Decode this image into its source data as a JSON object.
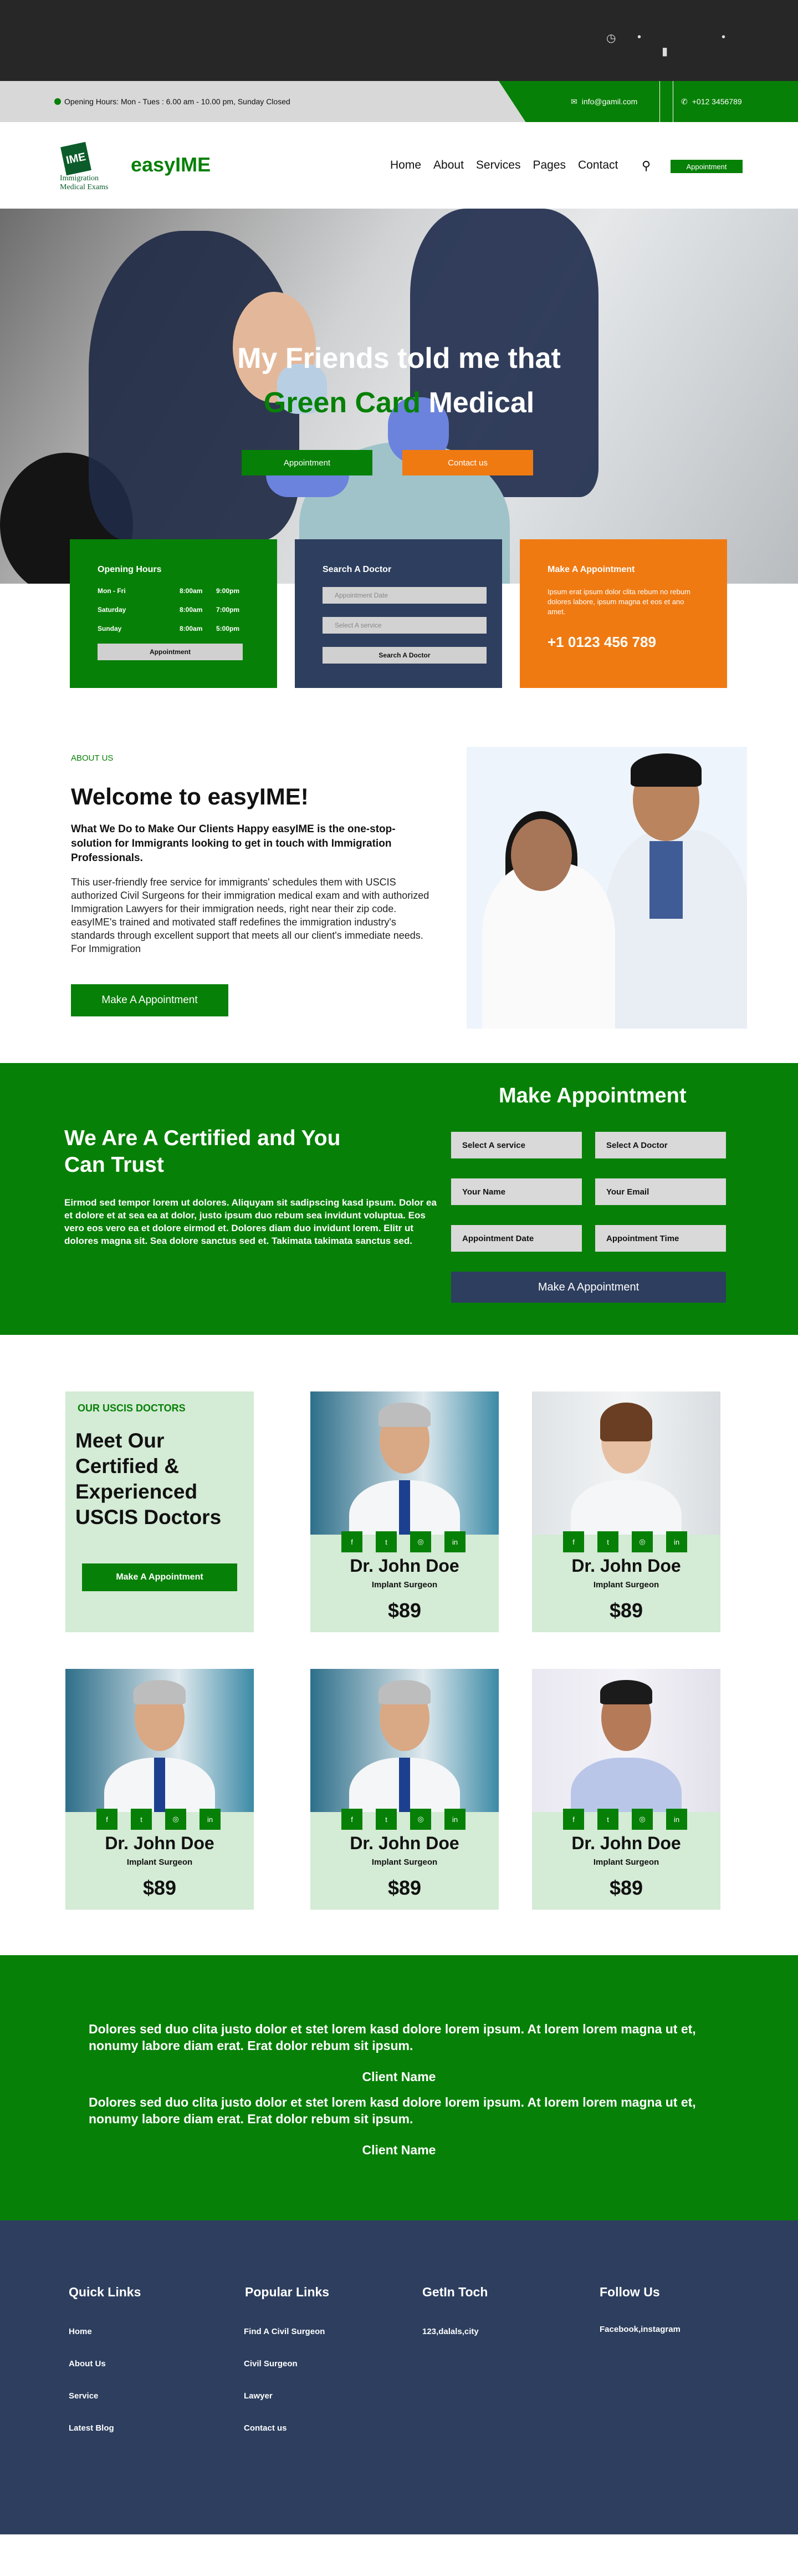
{
  "topbar": {
    "hours": "Opening Hours: Mon - Tues : 6.00 am - 10.00 pm, Sunday Closed",
    "email": "info@gamil.com",
    "phone": "+012 3456789"
  },
  "nav": {
    "logo_text": "Immigration Medical Exams",
    "logo_mark": "IME",
    "brand": "easyIME",
    "menu": [
      "Home",
      "About",
      "Services",
      "Pages",
      "Contact"
    ],
    "appointment": "Appointment"
  },
  "hero": {
    "line1": "My Friends told me that",
    "line2a": "Green Card",
    "line2b": " Medical",
    "btn_primary": "Appointment",
    "btn_secondary": "Contact us"
  },
  "cards": {
    "hours": {
      "title": "Opening Hours",
      "rows": [
        [
          "Mon - Fri",
          "8:00am",
          "9:00pm"
        ],
        [
          "Saturday",
          "8:00am",
          "7:00pm"
        ],
        [
          "Sunday",
          "8:00am",
          "5:00pm"
        ]
      ],
      "button": "Appointment"
    },
    "search": {
      "title": "Search A Doctor",
      "date_placeholder": "Appointment Date",
      "service_placeholder": "Select A service",
      "button": "Search A Doctor"
    },
    "make": {
      "title": "Make A Appointment",
      "text": "Ipsum erat ipsum dolor clita rebum no rebum dolores labore, ipsum magna et eos et ano amet.",
      "phone": "+1 0123 456 789"
    }
  },
  "about": {
    "tag": "ABOUT US",
    "title": "Welcome to easyIME!",
    "lead": "What We Do to Make Our Clients Happy easyIME is the one-stop-solution for Immigrants looking to get in touch with Immigration Professionals.",
    "body": "This user-friendly free service for immigrants' schedules them with USCIS authorized Civil Surgeons for their immigration medical exam and with authorized Immigration Lawyers for their immigration needs, right near their zip code. easyIME's trained and motivated staff redefines the immigration industry's standards through excellent support that meets all our client's immediate needs. For Immigration",
    "button": "Make A Appointment"
  },
  "appointment": {
    "heading": "Make Appointment",
    "title": "We Are A Certified and You Can Trust",
    "text": "Eirmod sed tempor lorem ut dolores. Aliquyam sit sadipscing kasd ipsum. Dolor ea et dolore et at sea ea at dolor, justo ipsum duo rebum sea invidunt voluptua. Eos vero eos vero ea et dolore eirmod et. Dolores diam duo invidunt lorem. Elitr ut dolores magna sit. Sea dolore sanctus sed et. Takimata takimata sanctus sed.",
    "fields": [
      "Select A service",
      "Select A Doctor",
      "Your Name",
      "Your Email",
      "Appointment Date",
      "Appointment Time"
    ],
    "button": "Make A Appointment"
  },
  "doctors": {
    "tag": "OUR USCIS DOCTORS",
    "title": "Meet Our Certified & Experienced USCIS Doctors",
    "button": "Make A Appointment",
    "list": [
      {
        "name": "Dr. John Doe",
        "role": "Implant Surgeon",
        "price": "$89"
      },
      {
        "name": "Dr. John Doe",
        "role": "Implant Surgeon",
        "price": "$89"
      },
      {
        "name": "Dr. John Doe",
        "role": "Implant Surgeon",
        "price": "$89"
      },
      {
        "name": "Dr. John Doe",
        "role": "Implant Surgeon",
        "price": "$89"
      },
      {
        "name": "Dr. John Doe",
        "role": "Implant Surgeon",
        "price": "$89"
      }
    ]
  },
  "testimonials": [
    {
      "quote": "Dolores sed duo clita justo dolor et stet lorem kasd dolore lorem ipsum. At lorem lorem magna ut et, nonumy labore diam erat. Erat dolor rebum sit ipsum.",
      "client": "Client Name"
    },
    {
      "quote": "Dolores sed duo clita justo dolor et stet lorem kasd dolore lorem ipsum. At lorem lorem magna ut et, nonumy labore diam erat. Erat dolor rebum sit ipsum.",
      "client": "Client Name"
    }
  ],
  "footer": {
    "quick": {
      "title": "Quick Links",
      "links": [
        "Home",
        "About Us",
        "Service",
        "Latest Blog"
      ]
    },
    "popular": {
      "title": "Popular Links",
      "links": [
        "Find A Civil Surgeon",
        "Civil Surgeon",
        "Lawyer",
        "Contact us"
      ]
    },
    "touch": {
      "title": "GetIn Toch",
      "address": "123,dalals,city"
    },
    "follow": {
      "title": "Follow Us",
      "links": "Facebook,instagram"
    }
  },
  "colors": {
    "brand_green": "#078007",
    "accent_orange": "#f07a12",
    "navy": "#2d3e5e",
    "light_green": "#d4ebd5"
  }
}
